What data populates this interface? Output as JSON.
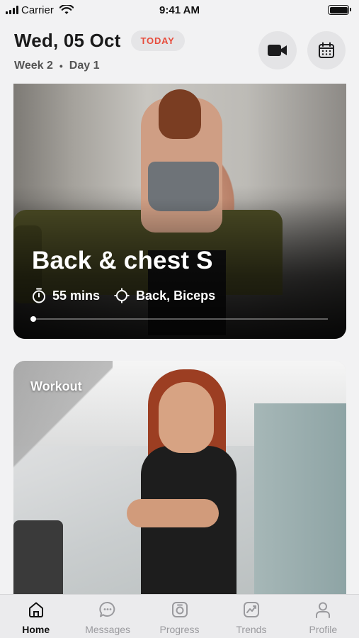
{
  "status_bar": {
    "carrier": "Carrier",
    "time": "9:41 AM"
  },
  "header": {
    "date": "Wed, 05 Oct",
    "today_badge": "TODAY",
    "week": "Week 2",
    "separator": "•",
    "day": "Day 1",
    "video_icon": "video-camera-icon",
    "calendar_icon": "calendar-icon"
  },
  "cards": [
    {
      "title": "Back & chest S",
      "duration": "55 mins",
      "target": "Back, Biceps",
      "duration_icon": "stopwatch-icon",
      "target_icon": "crosshair-icon",
      "progress": 0
    },
    {
      "label": "Workout"
    }
  ],
  "tab_bar": {
    "items": [
      {
        "label": "Home",
        "icon": "home-icon",
        "active": true
      },
      {
        "label": "Messages",
        "icon": "chat-bubble-icon",
        "active": false
      },
      {
        "label": "Progress",
        "icon": "progress-icon",
        "active": false
      },
      {
        "label": "Trends",
        "icon": "trend-chart-icon",
        "active": false
      },
      {
        "label": "Profile",
        "icon": "user-icon",
        "active": false
      }
    ]
  },
  "colors": {
    "accent_red": "#e74c3c",
    "background": "#f2f2f3",
    "tab_inactive": "#9a9a9e"
  }
}
